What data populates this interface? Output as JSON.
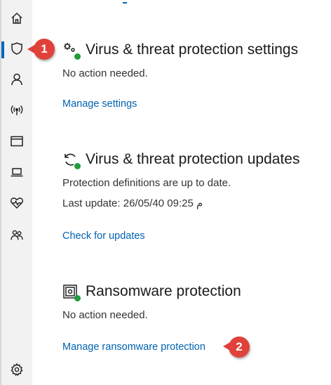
{
  "sidebar": {
    "items": [
      {
        "name": "home",
        "icon": "home-icon"
      },
      {
        "name": "virus-protection",
        "icon": "shield-icon",
        "active": true
      },
      {
        "name": "account",
        "icon": "person-icon"
      },
      {
        "name": "firewall-network",
        "icon": "wireless-icon"
      },
      {
        "name": "app-browser",
        "icon": "browser-window-icon"
      },
      {
        "name": "device-security",
        "icon": "laptop-icon"
      },
      {
        "name": "device-health",
        "icon": "heart-pulse-icon"
      },
      {
        "name": "family-options",
        "icon": "family-icon"
      },
      {
        "name": "settings",
        "icon": "gear-icon"
      }
    ]
  },
  "callouts": {
    "first": "1",
    "second": "2"
  },
  "sections": {
    "settings": {
      "title": "Virus & threat protection settings",
      "status": "No action needed.",
      "link": "Manage settings",
      "icon": "gear-check-icon"
    },
    "updates": {
      "title": "Virus & threat protection updates",
      "status": "Protection definitions are up to date.",
      "last_update": "Last update: 26/05/40 09:25 م",
      "link": "Check for updates",
      "icon": "refresh-check-icon"
    },
    "ransomware": {
      "title": "Ransomware protection",
      "status": "No action needed.",
      "link": "Manage ransomware protection",
      "icon": "ransomware-check-icon"
    }
  },
  "colors": {
    "accent": "#0067c0",
    "link": "#0063b1",
    "callout": "#e0413a",
    "ok": "#1f9c3c"
  }
}
